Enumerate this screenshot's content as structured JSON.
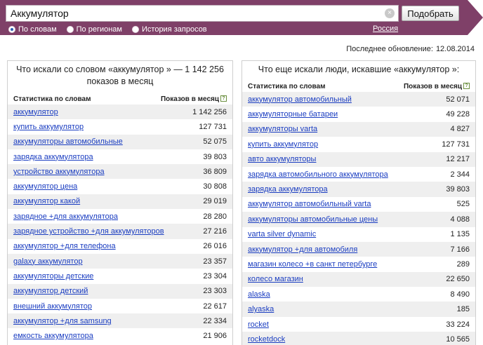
{
  "search": {
    "query": "Аккумулятор",
    "submit_label": "Подобрать",
    "clear_glyph": "×"
  },
  "modes": [
    {
      "label": "По словам",
      "checked": true
    },
    {
      "label": "По регионам",
      "checked": false
    },
    {
      "label": "История запросов",
      "checked": false
    }
  ],
  "region": "Россия",
  "updated": {
    "label": "Последнее обновление:",
    "date": "12.08.2014"
  },
  "left": {
    "title": "Что искали со словом «аккумулятор » — 1 142 256 показов в месяц",
    "col_words": "Статистика по словам",
    "col_count": "Показов в месяц",
    "help_glyph": "?",
    "rows": [
      {
        "phrase": "аккумулятор",
        "count": "1 142 256"
      },
      {
        "phrase": "купить аккумулятор",
        "count": "127 731"
      },
      {
        "phrase": "аккумуляторы автомобильные",
        "count": "52 075"
      },
      {
        "phrase": "зарядка аккумулятора",
        "count": "39 803"
      },
      {
        "phrase": "устройство аккумулятора",
        "count": "36 809"
      },
      {
        "phrase": "аккумулятор цена",
        "count": "30 808"
      },
      {
        "phrase": "аккумулятор какой",
        "count": "29 019"
      },
      {
        "phrase": "зарядное +для аккумулятора",
        "count": "28 280"
      },
      {
        "phrase": "зарядное устройство +для аккумуляторов",
        "count": "27 216"
      },
      {
        "phrase": "аккумулятор +для телефона",
        "count": "26 016"
      },
      {
        "phrase": "galaxy аккумулятор",
        "count": "23 357"
      },
      {
        "phrase": "аккумуляторы детские",
        "count": "23 304"
      },
      {
        "phrase": "аккумулятор детский",
        "count": "23 303"
      },
      {
        "phrase": "внешний аккумулятор",
        "count": "22 617"
      },
      {
        "phrase": "аккумулятор +для samsung",
        "count": "22 334"
      },
      {
        "phrase": "емкость аккумулятора",
        "count": "21 906"
      }
    ]
  },
  "right": {
    "title": "Что еще искали люди, искавшие «аккумулятор »:",
    "col_words": "Статистика по словам",
    "col_count": "Показов в месяц",
    "help_glyph": "?",
    "rows": [
      {
        "phrase": "аккумулятор автомобильный",
        "count": "52 071"
      },
      {
        "phrase": "аккумуляторные батареи",
        "count": "49 228"
      },
      {
        "phrase": "аккумуляторы varta",
        "count": "4 827"
      },
      {
        "phrase": "купить аккумулятор",
        "count": "127 731"
      },
      {
        "phrase": "авто аккумуляторы",
        "count": "12 217"
      },
      {
        "phrase": "зарядка автомобильного аккумулятора",
        "count": "2 344"
      },
      {
        "phrase": "зарядка аккумулятора",
        "count": "39 803"
      },
      {
        "phrase": "аккумулятор автомобильный varta",
        "count": "525"
      },
      {
        "phrase": "аккумуляторы автомобильные цены",
        "count": "4 088"
      },
      {
        "phrase": "varta silver dynamic",
        "count": "1 135"
      },
      {
        "phrase": "аккумулятор +для автомобиля",
        "count": "7 166"
      },
      {
        "phrase": "магазин колесо +в санкт петербурге",
        "count": "289"
      },
      {
        "phrase": "колесо магазин",
        "count": "22 650"
      },
      {
        "phrase": "alaska",
        "count": "8 490"
      },
      {
        "phrase": "alyaska",
        "count": "185"
      },
      {
        "phrase": "rocket",
        "count": "33 224"
      },
      {
        "phrase": "rocketdock",
        "count": "10 565"
      }
    ]
  }
}
